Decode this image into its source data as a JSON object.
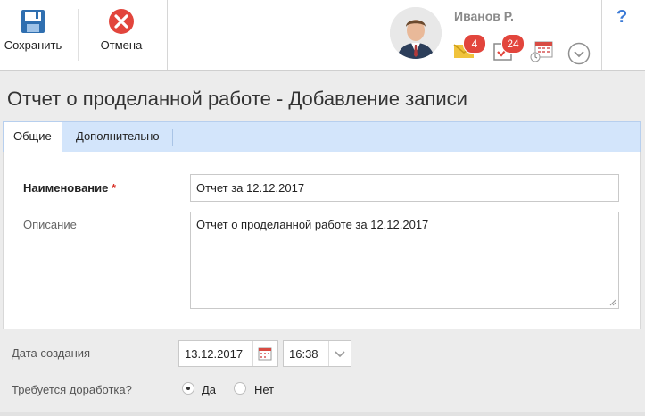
{
  "toolbar": {
    "save_label": "Сохранить",
    "cancel_label": "Отмена"
  },
  "user": {
    "name": "Иванов Р."
  },
  "notifications": {
    "mail_count": "4",
    "tasks_count": "24"
  },
  "help_label": "?",
  "page_title": "Отчет о проделанной работе - Добавление записи",
  "tabs": [
    {
      "label": "Общие",
      "active": true
    },
    {
      "label": "Дополнительно",
      "active": false
    }
  ],
  "form": {
    "name_label": "Наименование",
    "required_mark": "*",
    "name_value": "Отчет за 12.12.2017",
    "description_label": "Описание",
    "description_value": "Отчет о проделанной работе за 12.12.2017",
    "created_label": "Дата создания",
    "date_value": "13.12.2017",
    "time_value": "16:38",
    "rework_label": "Требуется доработка?",
    "rework_options": [
      {
        "label": "Да",
        "selected": true
      },
      {
        "label": "Нет",
        "selected": false
      }
    ]
  },
  "colors": {
    "accent_blue": "#3b7ad6",
    "badge_red": "#e2453c",
    "cancel_red": "#e2453c",
    "tab_bar": "#d3e5fb"
  }
}
